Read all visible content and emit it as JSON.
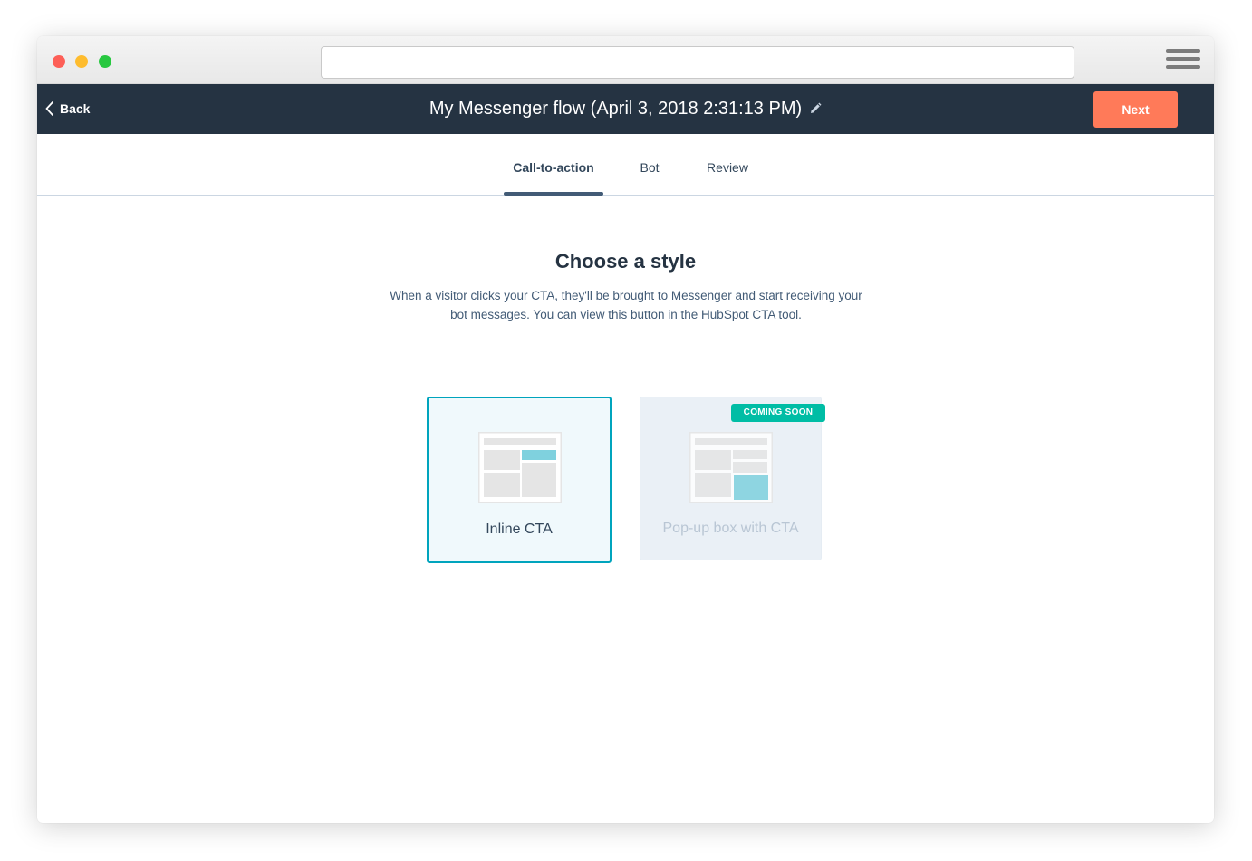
{
  "header": {
    "back_label": "Back",
    "title": "My Messenger flow (April 3, 2018 2:31:13 PM)",
    "next_label": "Next"
  },
  "tabs": [
    {
      "label": "Call-to-action",
      "active": true
    },
    {
      "label": "Bot",
      "active": false
    },
    {
      "label": "Review",
      "active": false
    }
  ],
  "main": {
    "heading": "Choose a style",
    "description": "When a visitor clicks your CTA, they'll be brought to Messenger and start receiving your bot messages. You can view this button in the HubSpot CTA tool.",
    "cards": [
      {
        "label": "Inline CTA",
        "selected": true
      },
      {
        "label": "Pop-up box with CTA",
        "badge": "COMING SOON",
        "disabled": true
      }
    ]
  },
  "colors": {
    "topbar": "#253342",
    "next_button": "#ff7a59",
    "selected_border": "#00a4bd",
    "badge": "#00bda5",
    "illustration_accent": "#7fd1de"
  },
  "icons": [
    "chevron-left-icon",
    "pencil-icon",
    "hamburger-menu-icon"
  ]
}
